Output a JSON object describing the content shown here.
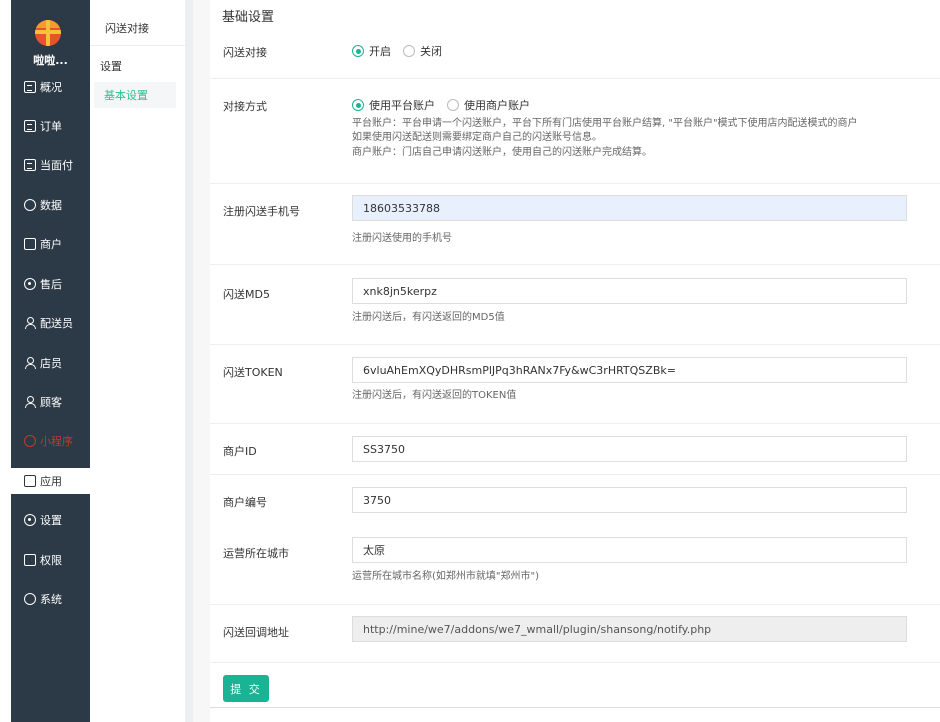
{
  "brand": {
    "name": "啦啦..."
  },
  "sidebar": {
    "items": [
      {
        "label": "概况",
        "icon": "overview-icon"
      },
      {
        "label": "订单",
        "icon": "order-icon"
      },
      {
        "label": "当面付",
        "icon": "pay-icon"
      },
      {
        "label": "数据",
        "icon": "chart-icon"
      },
      {
        "label": "商户",
        "icon": "store-icon"
      },
      {
        "label": "售后",
        "icon": "aftersale-icon"
      },
      {
        "label": "配送员",
        "icon": "deliveryman-icon"
      },
      {
        "label": "店员",
        "icon": "clerk-icon"
      },
      {
        "label": "顾客",
        "icon": "customer-icon"
      },
      {
        "label": "小程序",
        "icon": "miniprogram-icon"
      },
      {
        "label": "应用",
        "icon": "apps-icon"
      },
      {
        "label": "设置",
        "icon": "gear-icon"
      },
      {
        "label": "权限",
        "icon": "lock-icon"
      },
      {
        "label": "系统",
        "icon": "system-icon"
      }
    ],
    "active_index": 10,
    "highlight_index": 9,
    "highlight_color": "#c0392b"
  },
  "subnav": {
    "title": "闪送对接",
    "group": "设置",
    "item": "基本设置"
  },
  "form": {
    "section_title": "基础设置",
    "shansong_enable": {
      "label": "闪送对接",
      "options": [
        "开启",
        "关闭"
      ],
      "selected": "开启"
    },
    "connect_mode": {
      "label": "对接方式",
      "options": [
        "使用平台账户",
        "使用商户账户"
      ],
      "selected": "使用平台账户",
      "help1": "平台账户：平台申请一个闪送账户，平台下所有门店使用平台账户结算, \"平台账户\"模式下使用店内配送模式的商户",
      "help2": "如果使用闪送配送则需要绑定商户自己的闪送账号信息。",
      "help3": "商户账户：门店自己申请闪送账户，使用自己的闪送账户完成结算。"
    },
    "phone": {
      "label": "注册闪送手机号",
      "value": "18603533788",
      "help": "注册闪送使用的手机号"
    },
    "md5": {
      "label": "闪送MD5",
      "value": "xnk8jn5kerpz",
      "help": "注册闪送后，有闪送返回的MD5值"
    },
    "token": {
      "label": "闪送TOKEN",
      "value": "6vluAhEmXQyDHRsmPlJPq3hRANx7Fy&wC3rHRTQSZBk=",
      "help": "注册闪送后，有闪送返回的TOKEN值"
    },
    "merchant_id": {
      "label": "商户ID",
      "value": "SS3750"
    },
    "merchant_no": {
      "label": "商户编号",
      "value": "3750"
    },
    "city": {
      "label": "运营所在城市",
      "value": "太原",
      "help": "运营所在城市名称(如郑州市就填\"郑州市\")"
    },
    "callback": {
      "label": "闪送回调地址",
      "value": "http://mine/we7/addons/we7_wmall/plugin/shansong/notify.php"
    },
    "submit_label": "提 交"
  },
  "colors": {
    "accent": "#1ab394",
    "sidebar_bg": "#2c3a47"
  }
}
